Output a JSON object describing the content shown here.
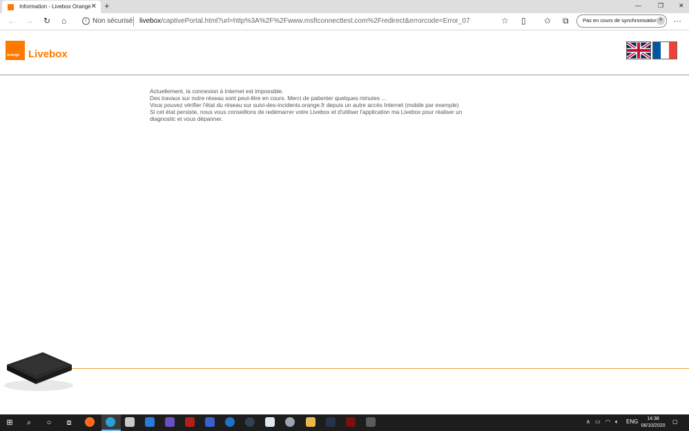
{
  "browser": {
    "tab": {
      "title": "Information - Livebox Orange",
      "close": "✕"
    },
    "new_tab": "+",
    "window_controls": {
      "minimize": "—",
      "maximize": "❐",
      "close": "✕"
    },
    "address": {
      "security_label": "Non sécurisé",
      "url_host": "livebox",
      "url_rest": "/captivePortal.html?url=http%3A%2F%2Fwww.msftconnecttest.com%2Fredirect&errorcode=Error_07"
    },
    "sync_button": "Pas en cours de synchronisation",
    "more": "···"
  },
  "page": {
    "logo_small_text": "orange",
    "brand": "Livebox",
    "message_lines": [
      "Actuellement, la connexion à Internet est impossible.",
      "Des travaux sur notre réseau sont peut-être en cours. Merci de patienter quelques minutes ...",
      "Vous pouvez vérifier l'état du réseau sur suivi-des-incidents.orange.fr depuis un autre accès Internet (mobile par exemple)",
      "Si cet état persiste, nous vous conseillons de redémarrer votre Livebox et d'utiliser l'application ma Livebox pour réaliser un diagnostic et vous dépanner."
    ],
    "colors": {
      "brand_orange": "#ff7900",
      "footer_rule": "#f0a030"
    }
  },
  "taskbar": {
    "tray": {
      "language": "ENG"
    },
    "clock": {
      "time": "14:38",
      "date": "06/10/2020"
    }
  }
}
